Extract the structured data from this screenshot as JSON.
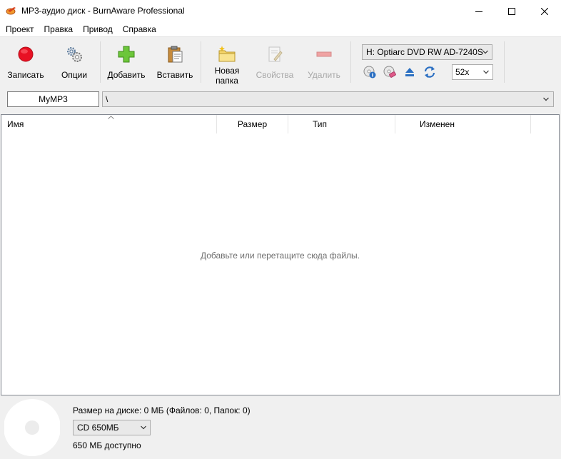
{
  "window": {
    "title": "MP3-аудио диск - BurnAware Professional"
  },
  "menu": [
    "Проект",
    "Правка",
    "Привод",
    "Справка"
  ],
  "toolbar": {
    "record_label": "Записать",
    "options_label": "Опции",
    "add_label": "Добавить",
    "paste_label": "Вставить",
    "new_folder_label_1": "Новая",
    "new_folder_label_2": "папка",
    "properties_label": "Свойства",
    "delete_label": "Удалить",
    "drive": "H: Optiarc DVD RW AD-7240S",
    "speed": "52x"
  },
  "pathbar": {
    "disc_label": "MyMP3",
    "path": "\\"
  },
  "filelist": {
    "columns": [
      "Имя",
      "Размер",
      "Тип",
      "Изменен"
    ],
    "empty_hint": "Добавьте или перетащите сюда файлы."
  },
  "status": {
    "size_text": "Размер на диске: 0 МБ (Файлов: 0, Папок: 0)",
    "media": "CD 650МБ",
    "available": "650 МБ доступно"
  },
  "colors": {
    "record_red": "#e81123",
    "add_green": "#5cb82a",
    "accent_blue": "#2b6fc2"
  }
}
